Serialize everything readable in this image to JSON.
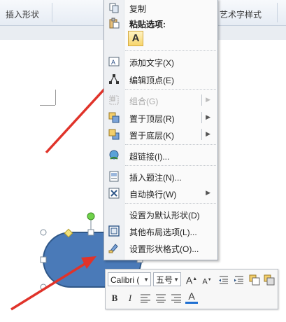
{
  "ribbon": {
    "group_left": "插入形状",
    "group_right": "艺术字样式"
  },
  "context_menu": {
    "items": [
      {
        "label": "复制",
        "icon": "copy-icon"
      },
      {
        "label": "粘贴选项:",
        "icon": "paste-icon"
      },
      {
        "label": "A",
        "icon": "paste-keep-text-icon"
      },
      {
        "label": "添加文字(X)",
        "icon": "add-text-icon"
      },
      {
        "label": "编辑顶点(E)",
        "icon": "edit-points-icon"
      },
      {
        "label": "组合(G)",
        "icon": "group-icon",
        "disabled": true
      },
      {
        "label": "置于顶层(R)",
        "icon": "bring-to-front-icon"
      },
      {
        "label": "置于底层(K)",
        "icon": "send-to-back-icon"
      },
      {
        "label": "超链接(I)...",
        "icon": "hyperlink-icon"
      },
      {
        "label": "插入题注(N)...",
        "icon": "insert-caption-icon"
      },
      {
        "label": "自动换行(W)",
        "icon": "text-wrap-icon"
      },
      {
        "label": "设置为默认形状(D)",
        "icon": ""
      },
      {
        "label": "其他布局选项(L)...",
        "icon": "layout-options-icon"
      },
      {
        "label": "设置形状格式(O)...",
        "icon": "format-shape-icon"
      }
    ]
  },
  "mini_toolbar": {
    "font_name": "Calibri (",
    "font_size": "五号",
    "grow_font": "A",
    "shrink_font": "A",
    "bold": "B",
    "italic": "I",
    "font_color": "A"
  },
  "colors": {
    "shape_fill": "#4a7ab8",
    "shape_stroke": "#2f5788",
    "arrow": "#e0332a"
  }
}
